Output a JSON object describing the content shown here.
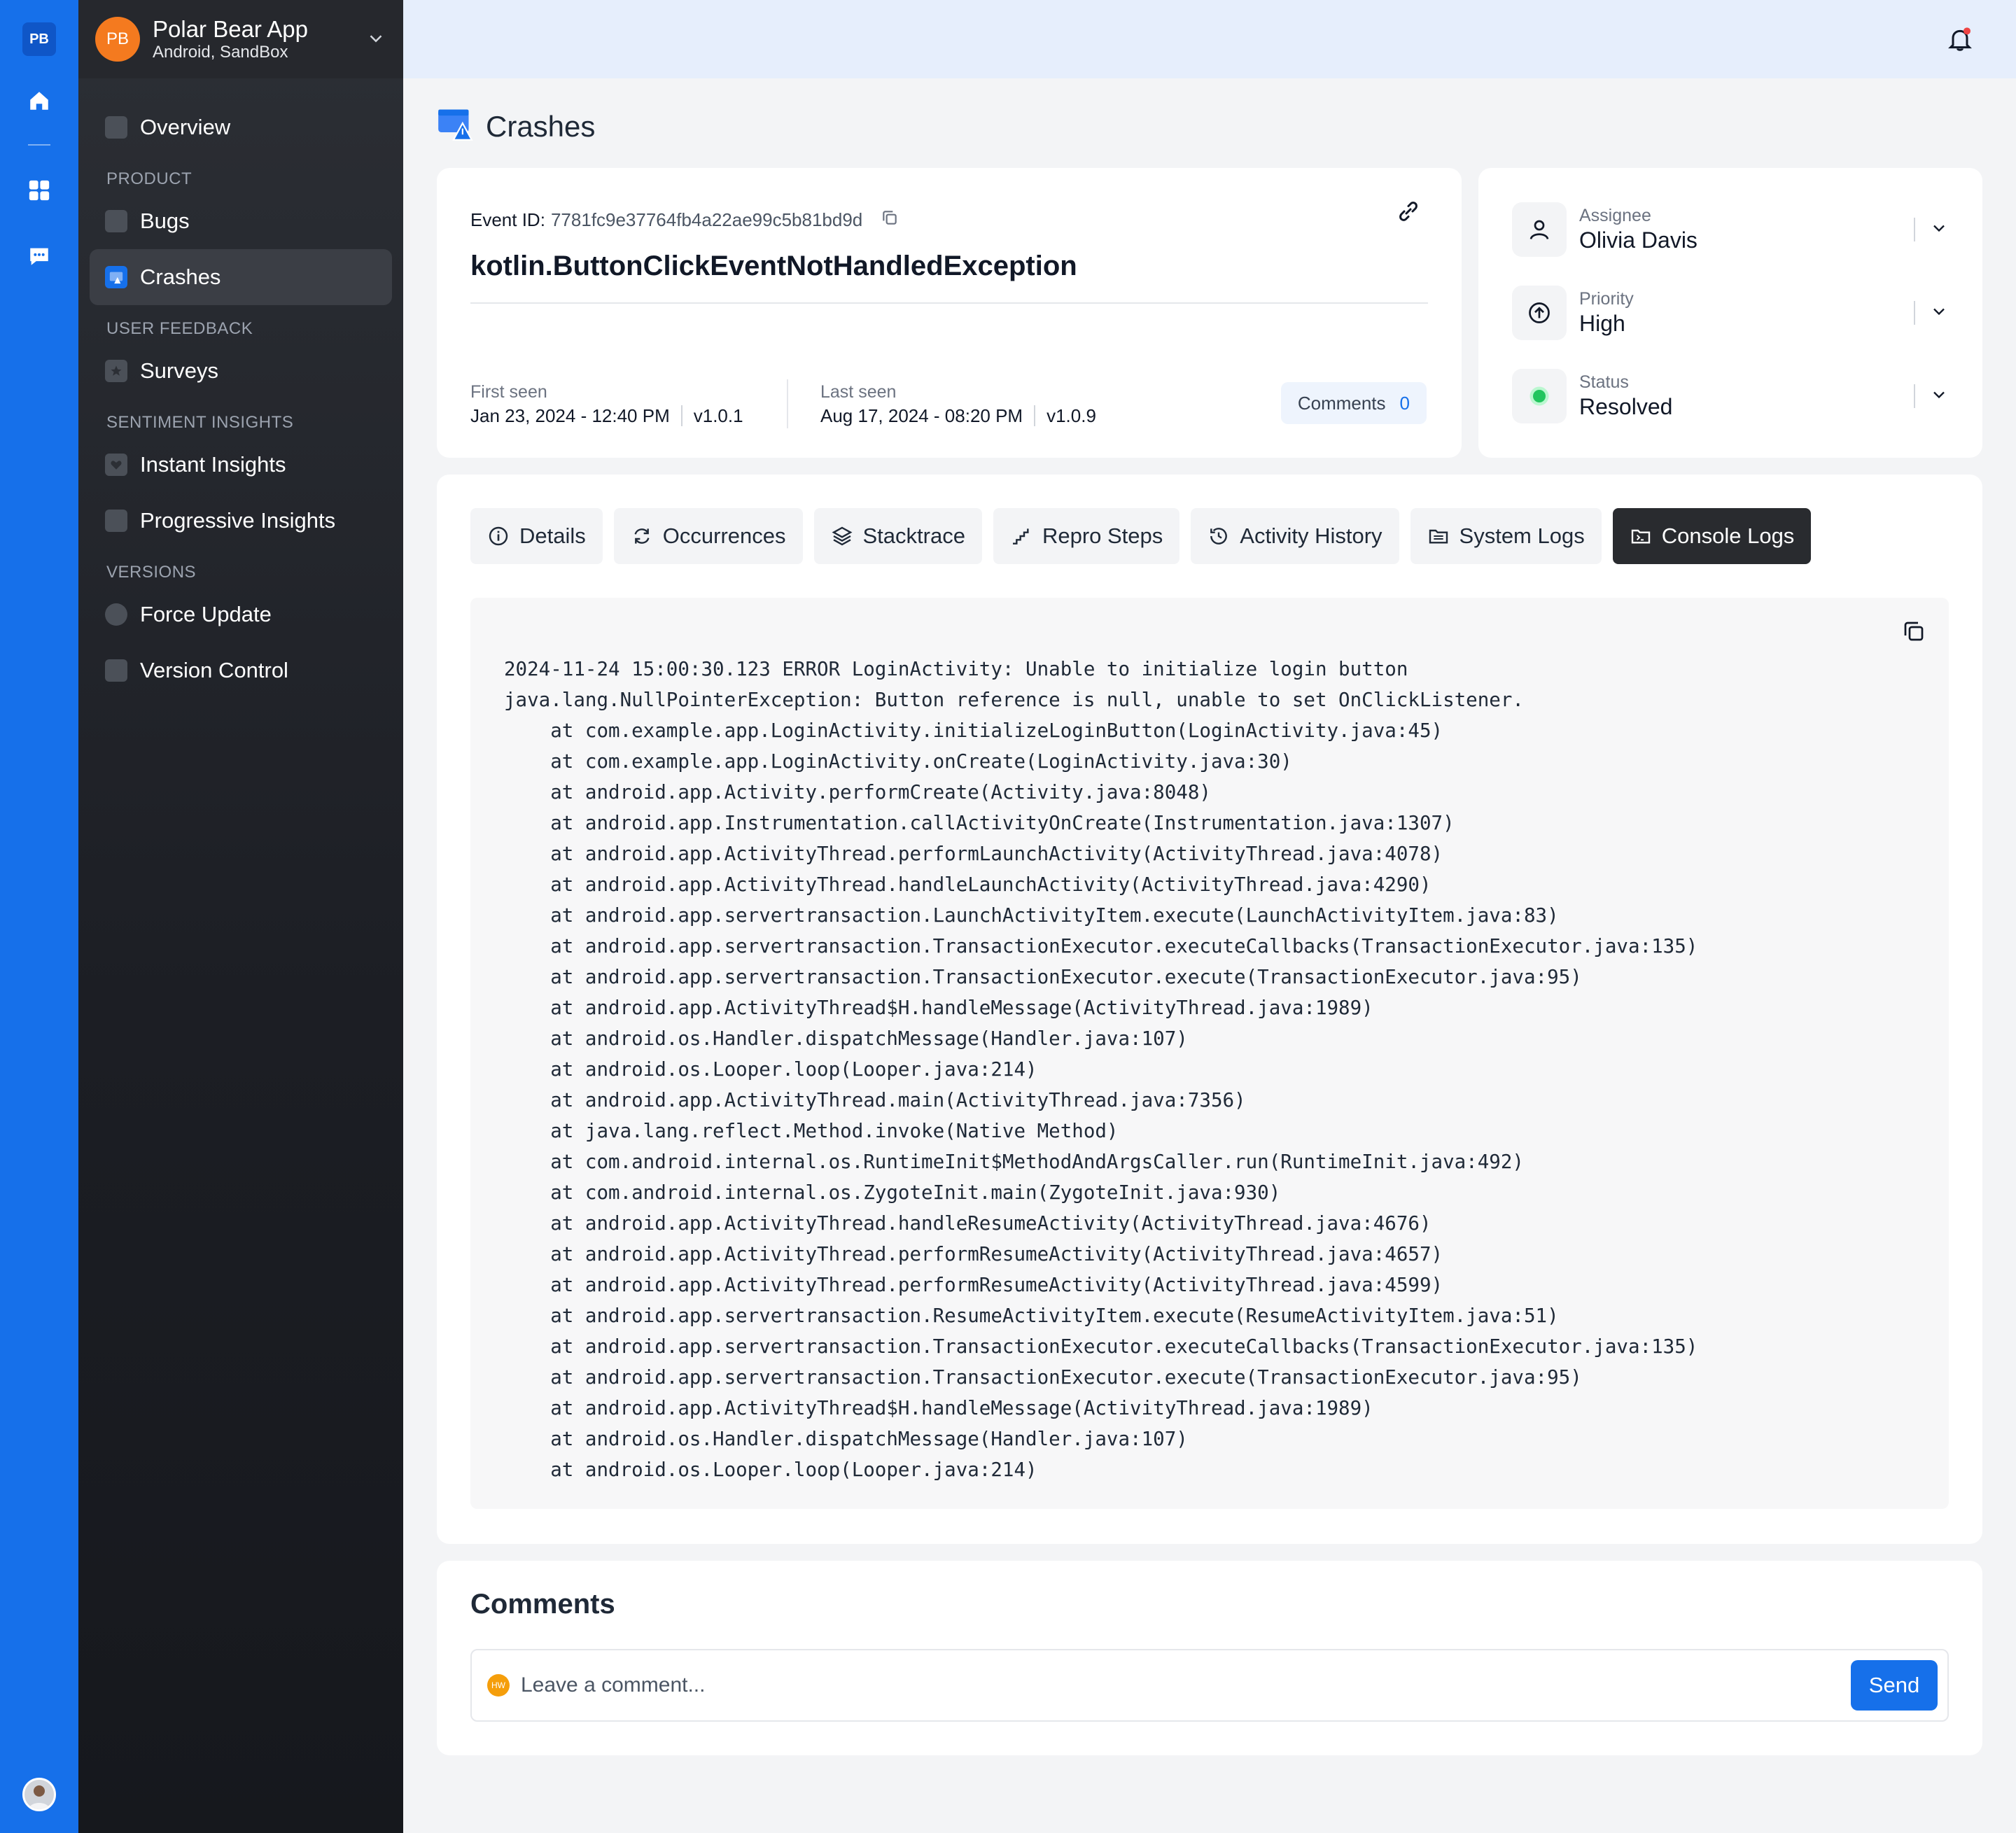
{
  "rail": {
    "badge": "PB",
    "icons": [
      "home-icon",
      "grid-icon",
      "chat-icon"
    ]
  },
  "app": {
    "logo": "PB",
    "name": "Polar Bear App",
    "subtitle": "Android, SandBox"
  },
  "sidebar": {
    "overview": "Overview",
    "sections": {
      "product": "PRODUCT",
      "user_feedback": "USER FEEDBACK",
      "sentiment": "SENTIMENT INSIGHTS",
      "versions": "VERSIONS"
    },
    "items": {
      "bugs": "Bugs",
      "crashes": "Crashes",
      "surveys": "Surveys",
      "instant_insights": "Instant Insights",
      "progressive_insights": "Progressive Insights",
      "force_update": "Force Update",
      "version_control": "Version Control"
    }
  },
  "page": {
    "title": "Crashes"
  },
  "event": {
    "id_label": "Event ID:",
    "id_value": "7781fc9e37764fb4a22ae99c5b81bd9d",
    "exception": "kotlin.ButtonClickEventNotHandledException",
    "first_seen_label": "First seen",
    "first_seen_value": "Jan 23, 2024 - 12:40 PM",
    "first_seen_version": "v1.0.1",
    "last_seen_label": "Last seen",
    "last_seen_value": "Aug 17, 2024 - 08:20 PM",
    "last_seen_version": "v1.0.9",
    "comments_label": "Comments",
    "comments_count": "0"
  },
  "meta": {
    "assignee_label": "Assignee",
    "assignee_value": "Olivia Davis",
    "priority_label": "Priority",
    "priority_value": "High",
    "status_label": "Status",
    "status_value": "Resolved",
    "status_color": "#22c55e"
  },
  "tabs": {
    "details": "Details",
    "occurrences": "Occurrences",
    "stacktrace": "Stacktrace",
    "repro_steps": "Repro Steps",
    "activity_history": "Activity History",
    "system_logs": "System Logs",
    "console_logs": "Console Logs",
    "active": "console_logs"
  },
  "logs": {
    "text": "2024-11-24 15:00:30.123 ERROR LoginActivity: Unable to initialize login button\njava.lang.NullPointerException: Button reference is null, unable to set OnClickListener.\n    at com.example.app.LoginActivity.initializeLoginButton(LoginActivity.java:45)\n    at com.example.app.LoginActivity.onCreate(LoginActivity.java:30)\n    at android.app.Activity.performCreate(Activity.java:8048)\n    at android.app.Instrumentation.callActivityOnCreate(Instrumentation.java:1307)\n    at android.app.ActivityThread.performLaunchActivity(ActivityThread.java:4078)\n    at android.app.ActivityThread.handleLaunchActivity(ActivityThread.java:4290)\n    at android.app.servertransaction.LaunchActivityItem.execute(LaunchActivityItem.java:83)\n    at android.app.servertransaction.TransactionExecutor.executeCallbacks(TransactionExecutor.java:135)\n    at android.app.servertransaction.TransactionExecutor.execute(TransactionExecutor.java:95)\n    at android.app.ActivityThread$H.handleMessage(ActivityThread.java:1989)\n    at android.os.Handler.dispatchMessage(Handler.java:107)\n    at android.os.Looper.loop(Looper.java:214)\n    at android.app.ActivityThread.main(ActivityThread.java:7356)\n    at java.lang.reflect.Method.invoke(Native Method)\n    at com.android.internal.os.RuntimeInit$MethodAndArgsCaller.run(RuntimeInit.java:492)\n    at com.android.internal.os.ZygoteInit.main(ZygoteInit.java:930)\n    at android.app.ActivityThread.handleResumeActivity(ActivityThread.java:4676)\n    at android.app.ActivityThread.performResumeActivity(ActivityThread.java:4657)\n    at android.app.ActivityThread.performResumeActivity(ActivityThread.java:4599)\n    at android.app.servertransaction.ResumeActivityItem.execute(ResumeActivityItem.java:51)\n    at android.app.servertransaction.TransactionExecutor.executeCallbacks(TransactionExecutor.java:135)\n    at android.app.servertransaction.TransactionExecutor.execute(TransactionExecutor.java:95)\n    at android.app.ActivityThread$H.handleMessage(ActivityThread.java:1989)\n    at android.os.Handler.dispatchMessage(Handler.java:107)\n    at android.os.Looper.loop(Looper.java:214)"
  },
  "comments": {
    "title": "Comments",
    "avatar_initials": "HW",
    "placeholder": "Leave a comment...",
    "send_label": "Send"
  },
  "colors": {
    "accent": "#1670ea",
    "logo": "#f47a1f",
    "notification_dot": "#ef4444"
  }
}
